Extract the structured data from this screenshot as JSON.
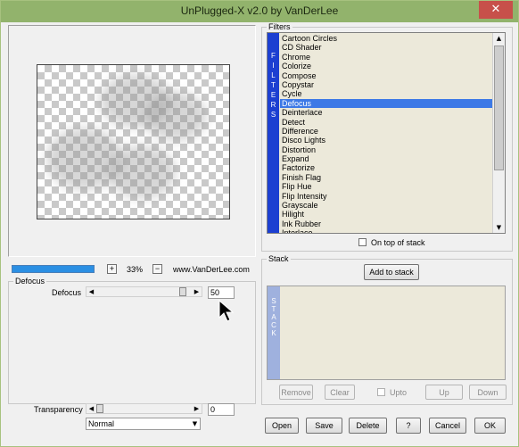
{
  "window": {
    "title": "UnPlugged-X v2.0 by VanDerLee",
    "close_glyph": "✕"
  },
  "preview": {
    "zoom_in_label": "+",
    "zoom_percent": "33%",
    "zoom_out_label": "−",
    "website": "www.VanDerLee.com",
    "progress_fraction": 1.0
  },
  "defocus_group": {
    "title": "Defocus",
    "param_label": "Defocus",
    "param_value": "50",
    "param_fraction": 0.94
  },
  "bottom_left": {
    "transparency_label": "Transparency",
    "transparency_value": "0",
    "transparency_fraction": 0.0,
    "blend_mode": "Normal"
  },
  "filters": {
    "title": "Filters",
    "vertical_label": [
      "F",
      "I",
      "L",
      "T",
      "E",
      "R",
      "S"
    ],
    "items": [
      "Cartoon Circles",
      "CD Shader",
      "Chrome",
      "Colorize",
      "Compose",
      "Copystar",
      "Cycle",
      "Defocus",
      "Deinterlace",
      "Detect",
      "Difference",
      "Disco Lights",
      "Distortion",
      "Expand",
      "Factorize",
      "Finish Flag",
      "Flip Hue",
      "Flip Intensity",
      "Grayscale",
      "Hilight",
      "Ink Rubber",
      "Interlace"
    ],
    "selected": "Defocus",
    "on_top_label": "On top of stack",
    "on_top_checked": false
  },
  "stack": {
    "title": "Stack",
    "add_label": "Add to stack",
    "vertical_label": [
      "S",
      "T",
      "A",
      "C",
      "K"
    ],
    "remove_label": "Remove",
    "clear_label": "Clear",
    "upto_label": "Upto",
    "up_label": "Up",
    "down_label": "Down"
  },
  "footer": {
    "open_label": "Open",
    "save_label": "Save",
    "delete_label": "Delete",
    "help_label": "?",
    "cancel_label": "Cancel",
    "ok_label": "OK"
  },
  "colors": {
    "title_bar": "#92b36c",
    "close_button": "#c7504a",
    "filters_bar": "#1c3fd1",
    "selection": "#3d79e6",
    "list_bg": "#ece9da",
    "progress": "#2b8fe3"
  }
}
